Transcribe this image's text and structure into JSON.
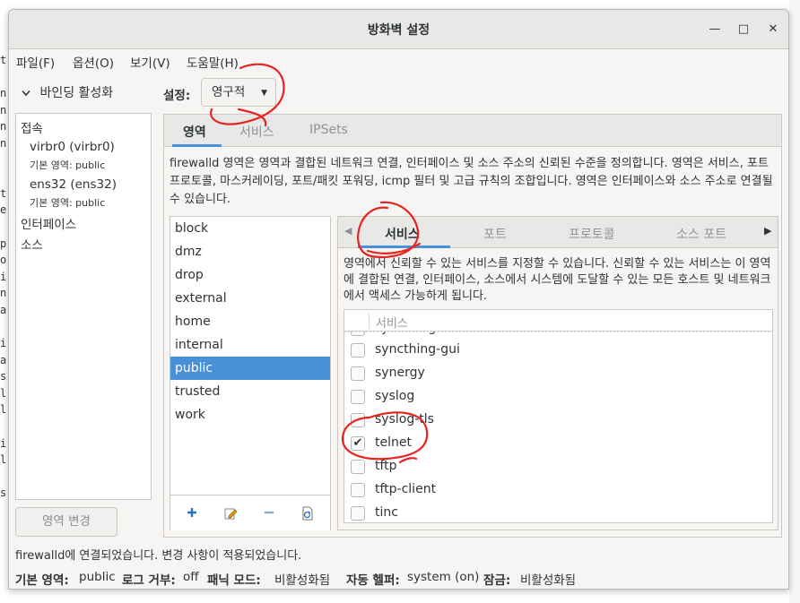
{
  "window": {
    "title": "방화벽 설정",
    "controls": {
      "minimize": "—",
      "maximize": "□",
      "close": "✕"
    }
  },
  "menu": [
    "파일(F)",
    "옵션(O)",
    "보기(V)",
    "도움말(H)"
  ],
  "sidebar": {
    "binding_label": "바인딩 활성화",
    "tree": {
      "connections_label": "접속",
      "connections": [
        {
          "name": "virbr0 (virbr0)",
          "default_zone": "기본 영역: public"
        },
        {
          "name": "ens32 (ens32)",
          "default_zone": "기본 영역: public"
        }
      ],
      "interfaces_label": "인터페이스",
      "sources_label": "소스"
    },
    "zone_change_button": "영역 변경"
  },
  "config": {
    "label": "설정:",
    "value": "영구적"
  },
  "outer_tabs": [
    "영역",
    "서비스",
    "IPSets"
  ],
  "zone_description": "firewalld 영역은 영역과 결합된 네트워크 연결, 인터페이스 및 소스 주소의 신뢰된 수준을 정의합니다. 영역은 서비스, 포트 프로토콜, 마스커레이딩, 포트/패킷 포워딩, icmp 필터 및 고급 규칙의 조합입니다. 영역은 인터페이스와 소스 주소로 연결될 수 있습니다.",
  "zones": [
    "block",
    "dmz",
    "drop",
    "external",
    "home",
    "internal",
    "public",
    "trusted",
    "work"
  ],
  "selected_zone": "public",
  "inner_tabs": [
    "서비스",
    "포트",
    "프로토콜",
    "소스 포트"
  ],
  "service_description": "영역에서 신뢰할 수 있는 서비스를 지정할 수 있습니다. 신뢰할 수 있는 서비스는 이 영역에 결합된 연결, 인터페이스, 소스에서 시스템에 도달할 수 있는 모든 호스트 및 네트워크에서 액세스 가능하게 됩니다.",
  "service_column": "서비스",
  "services": [
    {
      "name": "syncthing",
      "checked": false
    },
    {
      "name": "syncthing-gui",
      "checked": false
    },
    {
      "name": "synergy",
      "checked": false
    },
    {
      "name": "syslog",
      "checked": false
    },
    {
      "name": "syslog-tls",
      "checked": false
    },
    {
      "name": "telnet",
      "checked": true
    },
    {
      "name": "tftp",
      "checked": false
    },
    {
      "name": "tftp-client",
      "checked": false
    },
    {
      "name": "tinc",
      "checked": false
    }
  ],
  "status": {
    "message": "firewalld에 연결되었습니다. 변경 사항이 적용되었습니다.",
    "default_zone_label": "기본 영역:",
    "default_zone_value": "public",
    "log_denied_label": "로그 거부:",
    "log_denied_value": "off",
    "panic_label": "패닉 모드:",
    "panic_value": "비활성화됨",
    "helper_label": "자동 헬퍼:",
    "helper_value": "system (on)",
    "lockdown_label": "잠금:",
    "lockdown_value": "비활성화됨"
  },
  "background_terminal_letters": [
    "t",
    "",
    "n",
    "n",
    "n",
    "n",
    "",
    "",
    "t",
    "e",
    "",
    "p",
    "o",
    "i",
    "n",
    "a",
    "",
    "i",
    "a",
    "s",
    "l",
    "l",
    "",
    "i",
    "l",
    "",
    "s"
  ],
  "colors": {
    "accent": "#4a90d9",
    "annotation": "#e8231f"
  }
}
